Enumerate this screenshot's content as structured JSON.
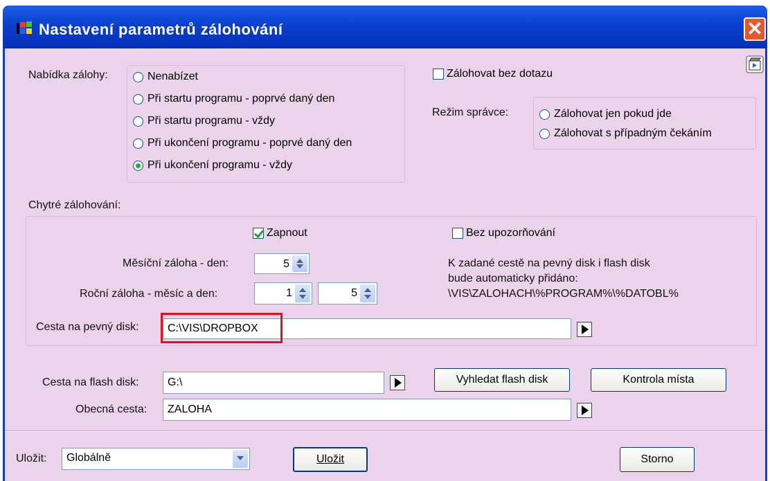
{
  "window": {
    "title": "Nastavení parametrů zálohování",
    "close_icon": "close-icon",
    "app_icon": "windows-flag-icon",
    "help_icon": "film-help-icon",
    "colors": {
      "titlebar": "#0a3fcf",
      "client": "#ecd3ec",
      "close": "#e8562a",
      "highlight": "#e0141e"
    }
  },
  "backup_offer": {
    "label": "Nabídka zálohy:",
    "options": [
      {
        "label": "Nenabízet",
        "selected": false
      },
      {
        "label": "Při startu programu - poprvé daný den",
        "selected": false
      },
      {
        "label": "Při startu programu - vždy",
        "selected": false
      },
      {
        "label": "Při ukončení programu - poprvé daný den",
        "selected": false
      },
      {
        "label": "Při ukončení programu - vždy",
        "selected": true
      }
    ]
  },
  "no_prompt": {
    "label": "Zálohovat bez dotazu",
    "checked": false
  },
  "admin_mode": {
    "label": "Režim správce:",
    "options": [
      {
        "label": "Zálohovat jen pokud jde",
        "selected": false
      },
      {
        "label": "Zálohovat s případným čekáním",
        "selected": false
      }
    ]
  },
  "smart": {
    "label": "Chytré zálohování:",
    "enable": {
      "label": "Zapnout",
      "checked": true
    },
    "no_warnings": {
      "label": "Bez upozorňování",
      "checked": false
    },
    "monthly": {
      "label": "Měsíční záloha - den:",
      "value": "5"
    },
    "yearly": {
      "label": "Roční záloha - měsíc a den:",
      "month": "1",
      "day": "5"
    },
    "info": [
      "K zadané cestě na pevný disk i flash disk",
      "bude automaticky přidáno:",
      "\\VIS\\ZALOHACH\\%PROGRAM%\\%DATOBL%"
    ],
    "hdd_path": {
      "label": "Cesta na pevný disk:",
      "value": "C:\\VIS\\DROPBOX"
    }
  },
  "flash": {
    "label": "Cesta na flash disk:",
    "value": "G:\\",
    "find_button": "Vyhledat flash disk",
    "check_button": "Kontrola místa"
  },
  "general_path": {
    "label": "Obecná cesta:",
    "value": "ZALOHA"
  },
  "footer": {
    "save_label": "Uložit:",
    "save_scope": "Globálně",
    "save_button": "Uložit",
    "cancel_button": "Storno"
  }
}
